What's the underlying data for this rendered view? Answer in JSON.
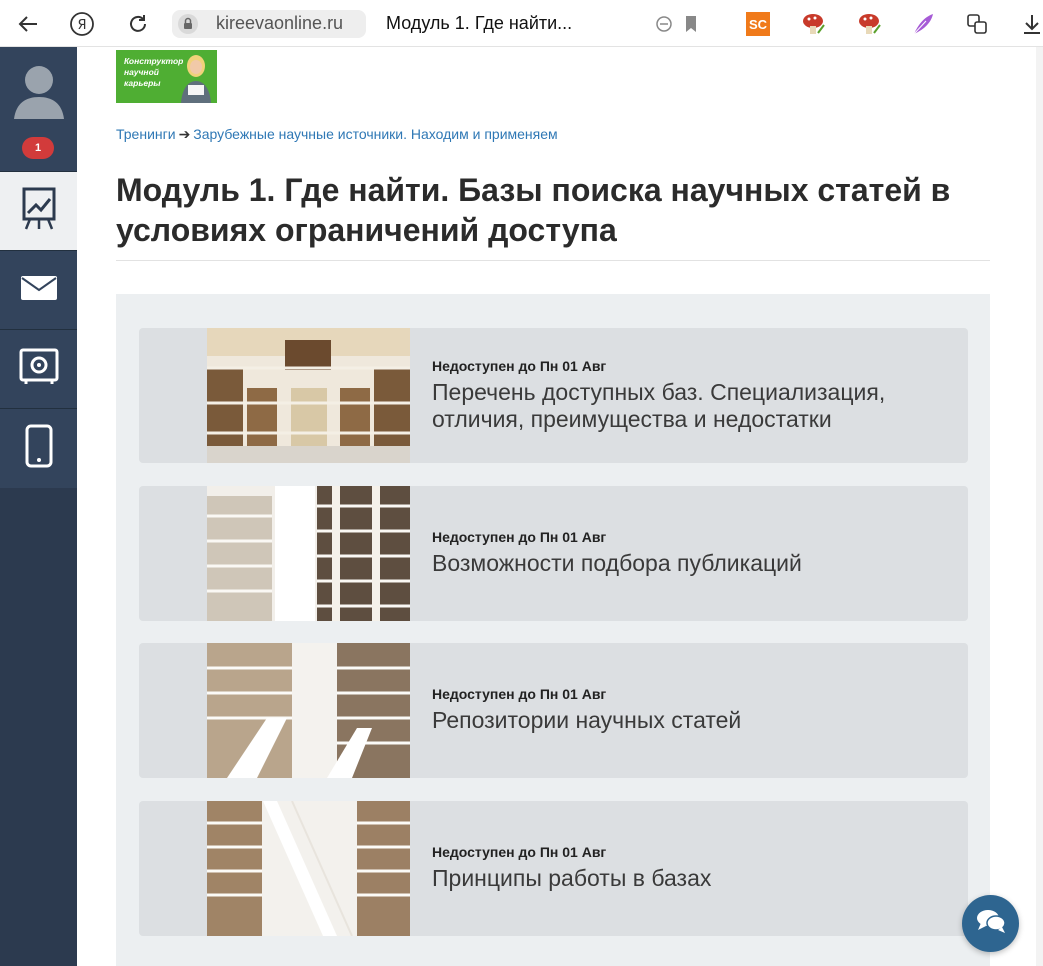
{
  "browser": {
    "domain": "kireevaonline.ru",
    "tab_title": "Модуль 1. Где найти...",
    "extension_sc_label": "SC",
    "icons": [
      "back-arrow-icon",
      "yandex-icon",
      "reload-icon",
      "lock-icon",
      "chat-bubble-icon",
      "bookmark-icon",
      "sc-extension-icon",
      "mushroom-extension-icon",
      "feather-extension-icon",
      "translate-icon",
      "download-icon"
    ]
  },
  "sidebar": {
    "notification_count": "1",
    "items": [
      {
        "name": "trainings",
        "icon": "chart-board-icon",
        "active": true
      },
      {
        "name": "messages",
        "icon": "envelope-icon",
        "active": false
      },
      {
        "name": "safe",
        "icon": "safe-icon",
        "active": false
      },
      {
        "name": "mobile",
        "icon": "phone-icon",
        "active": false
      }
    ]
  },
  "logo": {
    "text": "Конструктор научной карьеры"
  },
  "breadcrumb": {
    "root": "Тренинги",
    "separator": "➔",
    "current": "Зарубежные научные источники. Находим и применяем"
  },
  "page": {
    "title": "Модуль 1. Где найти. Базы поиска научных статей в условиях ограничений доступа"
  },
  "lessons": [
    {
      "status": "Недоступен до Пн 01 Авг",
      "title": "Перечень доступных баз. Специализация, отличия, преимущества и недостатки"
    },
    {
      "status": "Недоступен до Пн 01 Авг",
      "title": "Возможности подбора публикаций"
    },
    {
      "status": "Недоступен до Пн 01 Авг",
      "title": "Репозитории научных статей"
    },
    {
      "status": "Недоступен до Пн 01 Авг",
      "title": "Принципы работы в базах"
    }
  ],
  "colors": {
    "sidebar": "#2c3a4f",
    "link": "#2f78b5",
    "badge": "#d23b3b",
    "chat_button": "#2e6590",
    "panel": "#eceff1",
    "card": "#dcdfe2"
  }
}
